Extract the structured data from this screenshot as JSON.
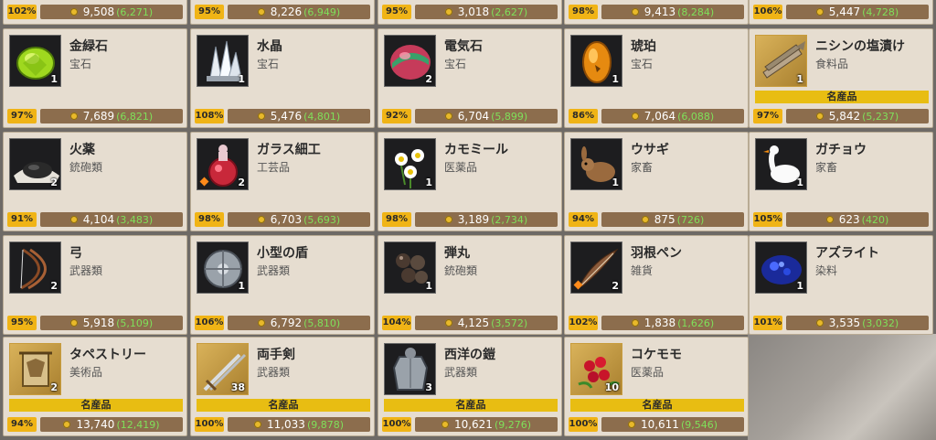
{
  "top_row": [
    {
      "percent": "102%",
      "price": "9,508",
      "original": "(6,271)"
    },
    {
      "percent": "95%",
      "price": "8,226",
      "original": "(6,949)"
    },
    {
      "percent": "95%",
      "price": "3,018",
      "original": "(2,627)"
    },
    {
      "percent": "98%",
      "price": "9,413",
      "original": "(8,284)"
    },
    {
      "percent": "106%",
      "price": "5,447",
      "original": "(4,728)"
    }
  ],
  "items": [
    {
      "name": "金緑石",
      "category": "宝石",
      "qty": "1",
      "percent": "97%",
      "price": "7,689",
      "original": "(6,821)",
      "icon": "chrysoberyl-icon",
      "special": false,
      "diamond": false
    },
    {
      "name": "水晶",
      "category": "宝石",
      "qty": "1",
      "percent": "108%",
      "price": "5,476",
      "original": "(4,801)",
      "icon": "quartz-crystal-icon",
      "special": false,
      "diamond": false
    },
    {
      "name": "電気石",
      "category": "宝石",
      "qty": "2",
      "percent": "92%",
      "price": "6,704",
      "original": "(5,899)",
      "icon": "tourmaline-icon",
      "special": false,
      "diamond": false
    },
    {
      "name": "琥珀",
      "category": "宝石",
      "qty": "1",
      "percent": "86%",
      "price": "7,064",
      "original": "(6,088)",
      "icon": "amber-icon",
      "special": false,
      "diamond": false
    },
    {
      "name": "ニシンの塩漬け",
      "category": "食料品",
      "qty": "1",
      "percent": "97%",
      "price": "5,842",
      "original": "(5,237)",
      "icon": "salted-herring-icon",
      "special": true,
      "diamond": false
    },
    {
      "name": "火薬",
      "category": "銃砲類",
      "qty": "2",
      "percent": "91%",
      "price": "4,104",
      "original": "(3,483)",
      "icon": "gunpowder-icon",
      "special": false,
      "diamond": false
    },
    {
      "name": "ガラス細工",
      "category": "工芸品",
      "qty": "2",
      "percent": "98%",
      "price": "6,703",
      "original": "(5,693)",
      "icon": "glasswork-icon",
      "special": false,
      "diamond": true
    },
    {
      "name": "カモミール",
      "category": "医薬品",
      "qty": "1",
      "percent": "98%",
      "price": "3,189",
      "original": "(2,734)",
      "icon": "chamomile-icon",
      "special": false,
      "diamond": false
    },
    {
      "name": "ウサギ",
      "category": "家畜",
      "qty": "1",
      "percent": "94%",
      "price": "875",
      "original": "(726)",
      "icon": "rabbit-icon",
      "special": false,
      "diamond": false
    },
    {
      "name": "ガチョウ",
      "category": "家畜",
      "qty": "1",
      "percent": "105%",
      "price": "623",
      "original": "(420)",
      "icon": "goose-icon",
      "special": false,
      "diamond": false
    },
    {
      "name": "弓",
      "category": "武器類",
      "qty": "2",
      "percent": "95%",
      "price": "5,918",
      "original": "(5,109)",
      "icon": "bow-icon",
      "special": false,
      "diamond": false
    },
    {
      "name": "小型の盾",
      "category": "武器類",
      "qty": "1",
      "percent": "106%",
      "price": "6,792",
      "original": "(5,810)",
      "icon": "small-shield-icon",
      "special": false,
      "diamond": false
    },
    {
      "name": "弾丸",
      "category": "銃砲類",
      "qty": "1",
      "percent": "104%",
      "price": "4,125",
      "original": "(3,572)",
      "icon": "bullets-icon",
      "special": false,
      "diamond": false
    },
    {
      "name": "羽根ペン",
      "category": "雑貨",
      "qty": "2",
      "percent": "102%",
      "price": "1,838",
      "original": "(1,626)",
      "icon": "quill-pen-icon",
      "special": false,
      "diamond": true
    },
    {
      "name": "アズライト",
      "category": "染料",
      "qty": "1",
      "percent": "101%",
      "price": "3,535",
      "original": "(3,032)",
      "icon": "azurite-icon",
      "special": false,
      "diamond": false
    },
    {
      "name": "タペストリー",
      "category": "美術品",
      "qty": "2",
      "percent": "94%",
      "price": "13,740",
      "original": "(12,419)",
      "icon": "tapestry-icon",
      "special": true,
      "diamond": false
    },
    {
      "name": "両手剣",
      "category": "武器類",
      "qty": "38",
      "percent": "100%",
      "price": "11,033",
      "original": "(9,878)",
      "icon": "two-handed-sword-icon",
      "special": true,
      "diamond": false
    },
    {
      "name": "西洋の鎧",
      "category": "武器類",
      "qty": "3",
      "percent": "100%",
      "price": "10,621",
      "original": "(9,276)",
      "icon": "western-armor-icon",
      "special": true,
      "diamond": false
    },
    {
      "name": "コケモモ",
      "category": "医薬品",
      "qty": "10",
      "percent": "100%",
      "price": "10,611",
      "original": "(9,546)",
      "icon": "lingonberry-icon",
      "special": true,
      "diamond": false
    }
  ],
  "labels": {
    "special": "名産品"
  },
  "colors": {
    "card": "#e6ddd0",
    "percent_badge": "#f0b416",
    "price_bar": "#8c6d4d",
    "original_price": "#7fe05a",
    "special_banner": "#e8bd12"
  }
}
